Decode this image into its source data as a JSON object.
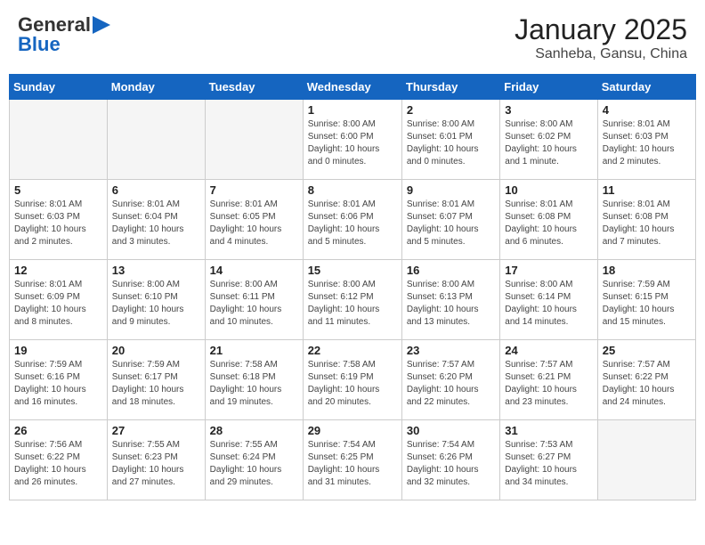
{
  "header": {
    "logo_line1": "General",
    "logo_line2": "Blue",
    "title": "January 2025",
    "subtitle": "Sanheba, Gansu, China"
  },
  "calendar": {
    "days_of_week": [
      "Sunday",
      "Monday",
      "Tuesday",
      "Wednesday",
      "Thursday",
      "Friday",
      "Saturday"
    ],
    "weeks": [
      [
        {
          "day": "",
          "info": ""
        },
        {
          "day": "",
          "info": ""
        },
        {
          "day": "",
          "info": ""
        },
        {
          "day": "1",
          "info": "Sunrise: 8:00 AM\nSunset: 6:00 PM\nDaylight: 10 hours\nand 0 minutes."
        },
        {
          "day": "2",
          "info": "Sunrise: 8:00 AM\nSunset: 6:01 PM\nDaylight: 10 hours\nand 0 minutes."
        },
        {
          "day": "3",
          "info": "Sunrise: 8:00 AM\nSunset: 6:02 PM\nDaylight: 10 hours\nand 1 minute."
        },
        {
          "day": "4",
          "info": "Sunrise: 8:01 AM\nSunset: 6:03 PM\nDaylight: 10 hours\nand 2 minutes."
        }
      ],
      [
        {
          "day": "5",
          "info": "Sunrise: 8:01 AM\nSunset: 6:03 PM\nDaylight: 10 hours\nand 2 minutes."
        },
        {
          "day": "6",
          "info": "Sunrise: 8:01 AM\nSunset: 6:04 PM\nDaylight: 10 hours\nand 3 minutes."
        },
        {
          "day": "7",
          "info": "Sunrise: 8:01 AM\nSunset: 6:05 PM\nDaylight: 10 hours\nand 4 minutes."
        },
        {
          "day": "8",
          "info": "Sunrise: 8:01 AM\nSunset: 6:06 PM\nDaylight: 10 hours\nand 5 minutes."
        },
        {
          "day": "9",
          "info": "Sunrise: 8:01 AM\nSunset: 6:07 PM\nDaylight: 10 hours\nand 5 minutes."
        },
        {
          "day": "10",
          "info": "Sunrise: 8:01 AM\nSunset: 6:08 PM\nDaylight: 10 hours\nand 6 minutes."
        },
        {
          "day": "11",
          "info": "Sunrise: 8:01 AM\nSunset: 6:08 PM\nDaylight: 10 hours\nand 7 minutes."
        }
      ],
      [
        {
          "day": "12",
          "info": "Sunrise: 8:01 AM\nSunset: 6:09 PM\nDaylight: 10 hours\nand 8 minutes."
        },
        {
          "day": "13",
          "info": "Sunrise: 8:00 AM\nSunset: 6:10 PM\nDaylight: 10 hours\nand 9 minutes."
        },
        {
          "day": "14",
          "info": "Sunrise: 8:00 AM\nSunset: 6:11 PM\nDaylight: 10 hours\nand 10 minutes."
        },
        {
          "day": "15",
          "info": "Sunrise: 8:00 AM\nSunset: 6:12 PM\nDaylight: 10 hours\nand 11 minutes."
        },
        {
          "day": "16",
          "info": "Sunrise: 8:00 AM\nSunset: 6:13 PM\nDaylight: 10 hours\nand 13 minutes."
        },
        {
          "day": "17",
          "info": "Sunrise: 8:00 AM\nSunset: 6:14 PM\nDaylight: 10 hours\nand 14 minutes."
        },
        {
          "day": "18",
          "info": "Sunrise: 7:59 AM\nSunset: 6:15 PM\nDaylight: 10 hours\nand 15 minutes."
        }
      ],
      [
        {
          "day": "19",
          "info": "Sunrise: 7:59 AM\nSunset: 6:16 PM\nDaylight: 10 hours\nand 16 minutes."
        },
        {
          "day": "20",
          "info": "Sunrise: 7:59 AM\nSunset: 6:17 PM\nDaylight: 10 hours\nand 18 minutes."
        },
        {
          "day": "21",
          "info": "Sunrise: 7:58 AM\nSunset: 6:18 PM\nDaylight: 10 hours\nand 19 minutes."
        },
        {
          "day": "22",
          "info": "Sunrise: 7:58 AM\nSunset: 6:19 PM\nDaylight: 10 hours\nand 20 minutes."
        },
        {
          "day": "23",
          "info": "Sunrise: 7:57 AM\nSunset: 6:20 PM\nDaylight: 10 hours\nand 22 minutes."
        },
        {
          "day": "24",
          "info": "Sunrise: 7:57 AM\nSunset: 6:21 PM\nDaylight: 10 hours\nand 23 minutes."
        },
        {
          "day": "25",
          "info": "Sunrise: 7:57 AM\nSunset: 6:22 PM\nDaylight: 10 hours\nand 24 minutes."
        }
      ],
      [
        {
          "day": "26",
          "info": "Sunrise: 7:56 AM\nSunset: 6:22 PM\nDaylight: 10 hours\nand 26 minutes."
        },
        {
          "day": "27",
          "info": "Sunrise: 7:55 AM\nSunset: 6:23 PM\nDaylight: 10 hours\nand 27 minutes."
        },
        {
          "day": "28",
          "info": "Sunrise: 7:55 AM\nSunset: 6:24 PM\nDaylight: 10 hours\nand 29 minutes."
        },
        {
          "day": "29",
          "info": "Sunrise: 7:54 AM\nSunset: 6:25 PM\nDaylight: 10 hours\nand 31 minutes."
        },
        {
          "day": "30",
          "info": "Sunrise: 7:54 AM\nSunset: 6:26 PM\nDaylight: 10 hours\nand 32 minutes."
        },
        {
          "day": "31",
          "info": "Sunrise: 7:53 AM\nSunset: 6:27 PM\nDaylight: 10 hours\nand 34 minutes."
        },
        {
          "day": "",
          "info": ""
        }
      ]
    ]
  }
}
